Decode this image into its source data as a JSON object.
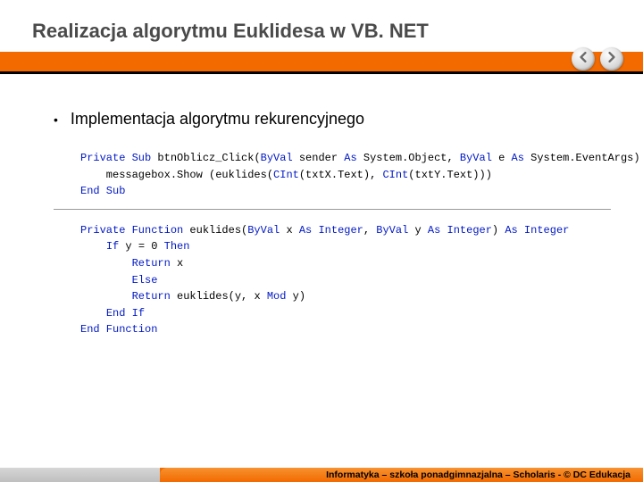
{
  "title": "Realizacja algorytmu Euklidesa w VB. NET",
  "bullet": "Implementacja algorytmu rekurencyjnego",
  "nav": {
    "prev": "prev",
    "next": "next"
  },
  "code": {
    "block1": [
      {
        "segments": [
          {
            "t": "Private Sub",
            "c": "kw"
          },
          {
            "t": " btnOblicz_Click("
          },
          {
            "t": "ByVal",
            "c": "kw"
          },
          {
            "t": " sender "
          },
          {
            "t": "As",
            "c": "kw"
          },
          {
            "t": " System.Object, "
          },
          {
            "t": "ByVal",
            "c": "kw"
          },
          {
            "t": " e "
          },
          {
            "t": "As",
            "c": "kw"
          },
          {
            "t": " System.EventArgs)"
          }
        ]
      },
      {
        "segments": [
          {
            "t": "    messagebox.Show (euklides("
          },
          {
            "t": "CInt",
            "c": "kw"
          },
          {
            "t": "(txtX.Text), "
          },
          {
            "t": "CInt",
            "c": "kw"
          },
          {
            "t": "(txtY.Text)))"
          }
        ]
      },
      {
        "segments": [
          {
            "t": "End Sub",
            "c": "kw"
          }
        ]
      }
    ],
    "block2": [
      {
        "segments": [
          {
            "t": "Private Function",
            "c": "kw"
          },
          {
            "t": " euklides("
          },
          {
            "t": "ByVal",
            "c": "kw"
          },
          {
            "t": " x "
          },
          {
            "t": "As Integer",
            "c": "kw"
          },
          {
            "t": ", "
          },
          {
            "t": "ByVal",
            "c": "kw"
          },
          {
            "t": " y "
          },
          {
            "t": "As Integer",
            "c": "kw"
          },
          {
            "t": ") "
          },
          {
            "t": "As Integer",
            "c": "kw"
          }
        ]
      },
      {
        "segments": [
          {
            "t": "    "
          },
          {
            "t": "If",
            "c": "kw"
          },
          {
            "t": " y = 0 "
          },
          {
            "t": "Then",
            "c": "kw"
          }
        ]
      },
      {
        "segments": [
          {
            "t": "        "
          },
          {
            "t": "Return",
            "c": "kw"
          },
          {
            "t": " x"
          }
        ]
      },
      {
        "segments": [
          {
            "t": "        "
          },
          {
            "t": "Else",
            "c": "kw"
          }
        ]
      },
      {
        "segments": [
          {
            "t": "        "
          },
          {
            "t": "Return",
            "c": "kw"
          },
          {
            "t": " euklides(y, x "
          },
          {
            "t": "Mod",
            "c": "kw"
          },
          {
            "t": " y)"
          }
        ]
      },
      {
        "segments": [
          {
            "t": "    "
          },
          {
            "t": "End If",
            "c": "kw"
          }
        ]
      },
      {
        "segments": [
          {
            "t": "End Function",
            "c": "kw"
          }
        ]
      }
    ]
  },
  "footer": "Informatyka – szkoła ponadgimnazjalna – Scholaris - © DC Edukacja"
}
